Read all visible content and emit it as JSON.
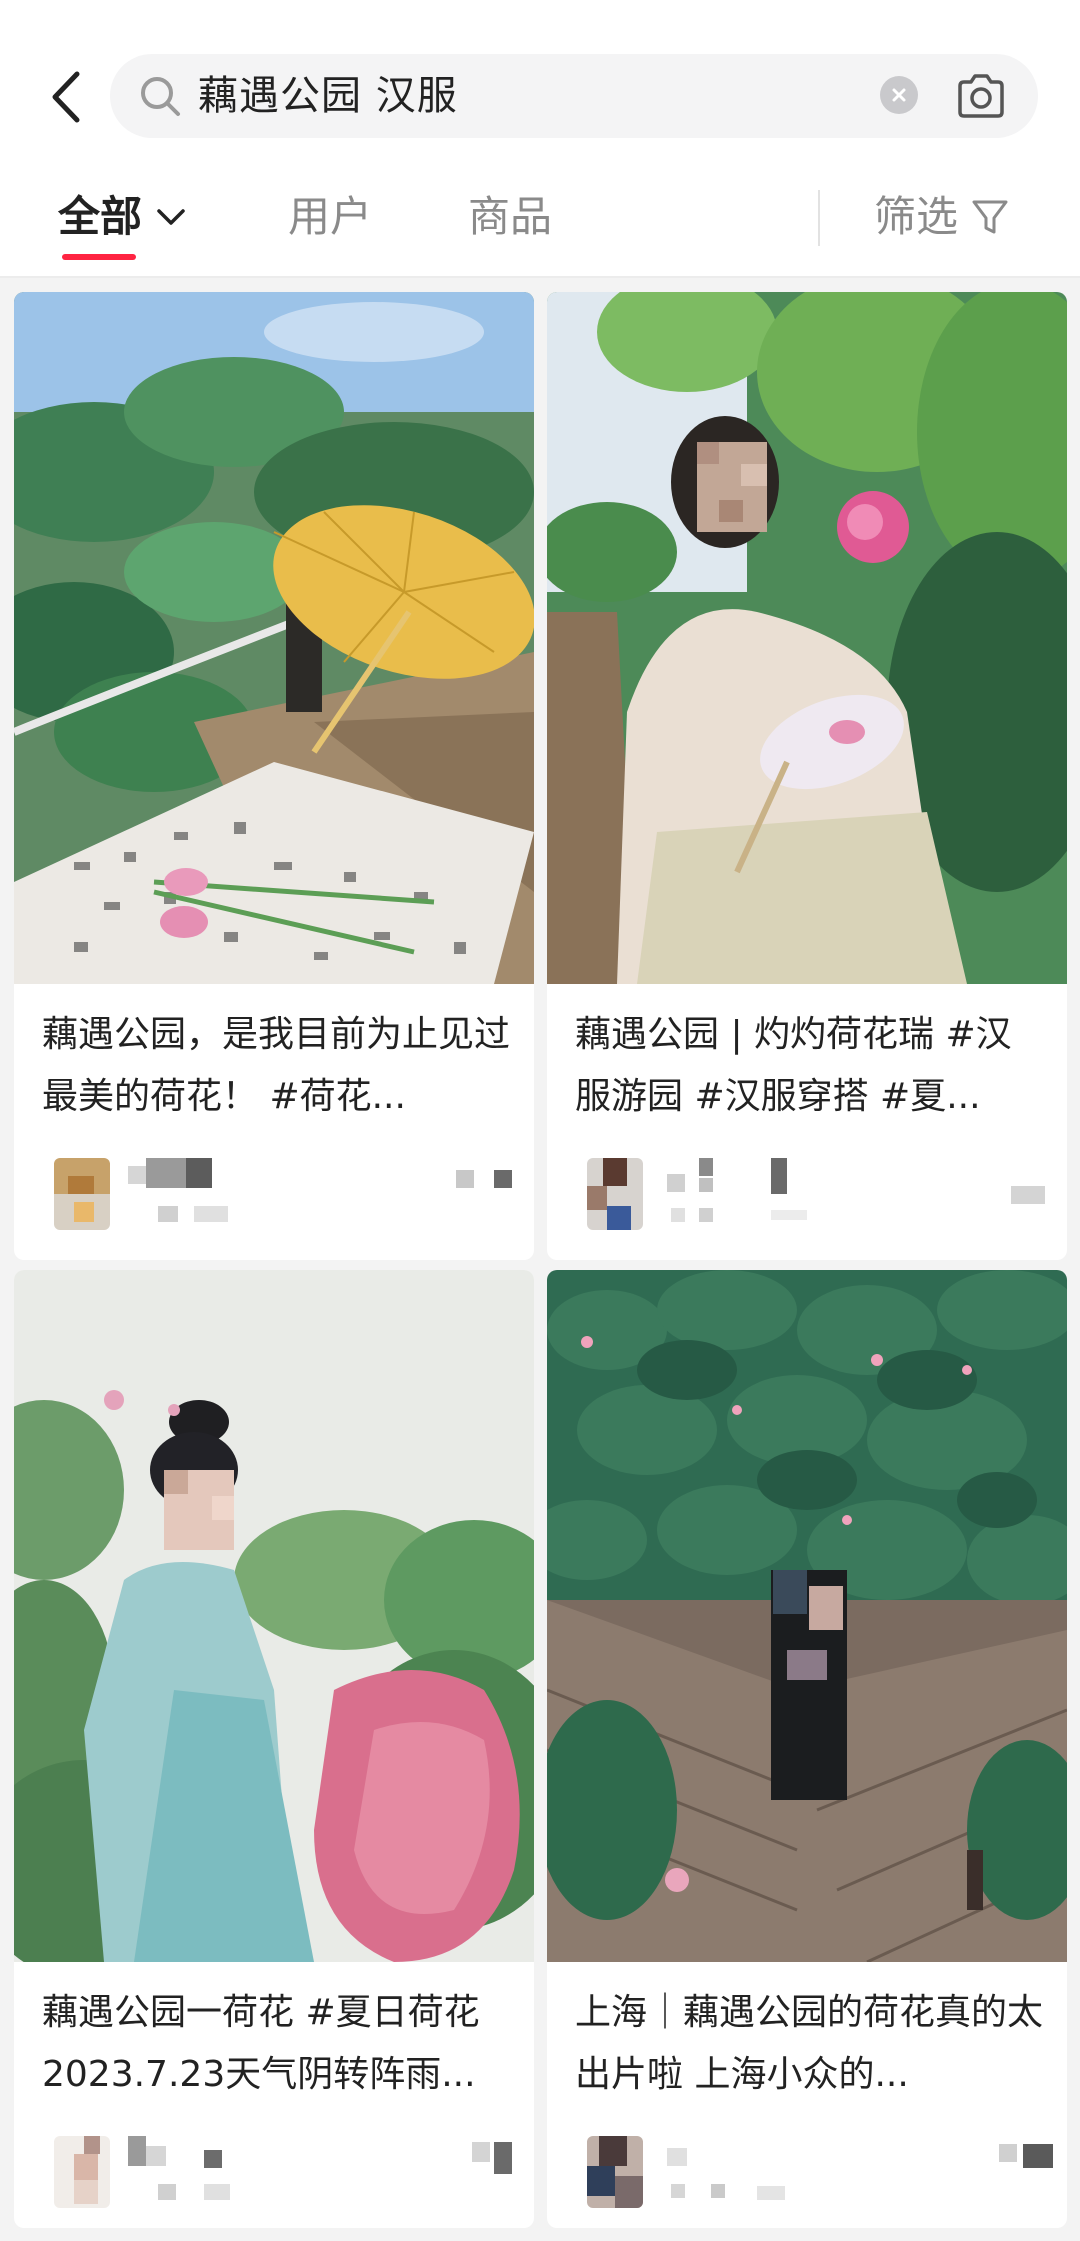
{
  "search": {
    "query": "藕遇公园 汉服"
  },
  "tabs": {
    "all": "全部",
    "users": "用户",
    "goods": "商品",
    "filter": "筛选"
  },
  "icons": {
    "back": "back-arrow-icon",
    "search": "search-icon",
    "clear": "clear-icon",
    "camera": "camera-icon",
    "chevron": "chevron-down-icon",
    "filter": "filter-icon"
  },
  "colors": {
    "accent": "#ff2442",
    "background": "#f3f3f3"
  },
  "notes": [
    {
      "title": "藕遇公园，是我目前为止见过最美的荷花！ #荷花..."
    },
    {
      "title": "藕遇公园 | 灼灼荷花瑞 #汉服游园 #汉服穿搭 #夏..."
    },
    {
      "title": "藕遇公园一荷花 #夏日荷花 2023.7.23天气阴转阵雨..."
    },
    {
      "title": "上海｜藕遇公园的荷花真的太出片啦 上海小众的..."
    }
  ]
}
